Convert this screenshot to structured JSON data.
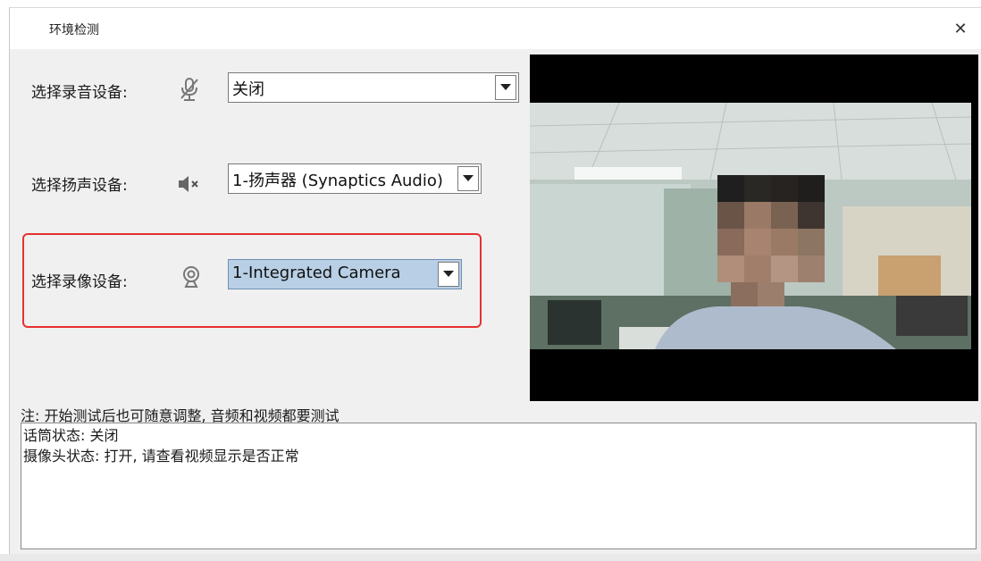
{
  "window": {
    "title": "环境检测",
    "close_symbol": "✕"
  },
  "mic_row": {
    "label": "选择录音设备:",
    "icon": "muted-microphone-icon",
    "value": "关闭"
  },
  "speaker_row": {
    "label": "选择扬声设备:",
    "icon": "muted-speaker-icon",
    "value": "1-扬声器 (Synaptics Audio)"
  },
  "camera_row": {
    "label": "选择录像设备:",
    "icon": "webcam-icon",
    "value": "1-Integrated Camera"
  },
  "highlight_color": "#e83030",
  "note": "注: 开始测试后也可随意调整, 音频和视频都要测试",
  "status": {
    "mic_line": "话筒状态: 关闭",
    "camera_line": "摄像头状态: 打开, 请查看视频显示是否正常"
  }
}
